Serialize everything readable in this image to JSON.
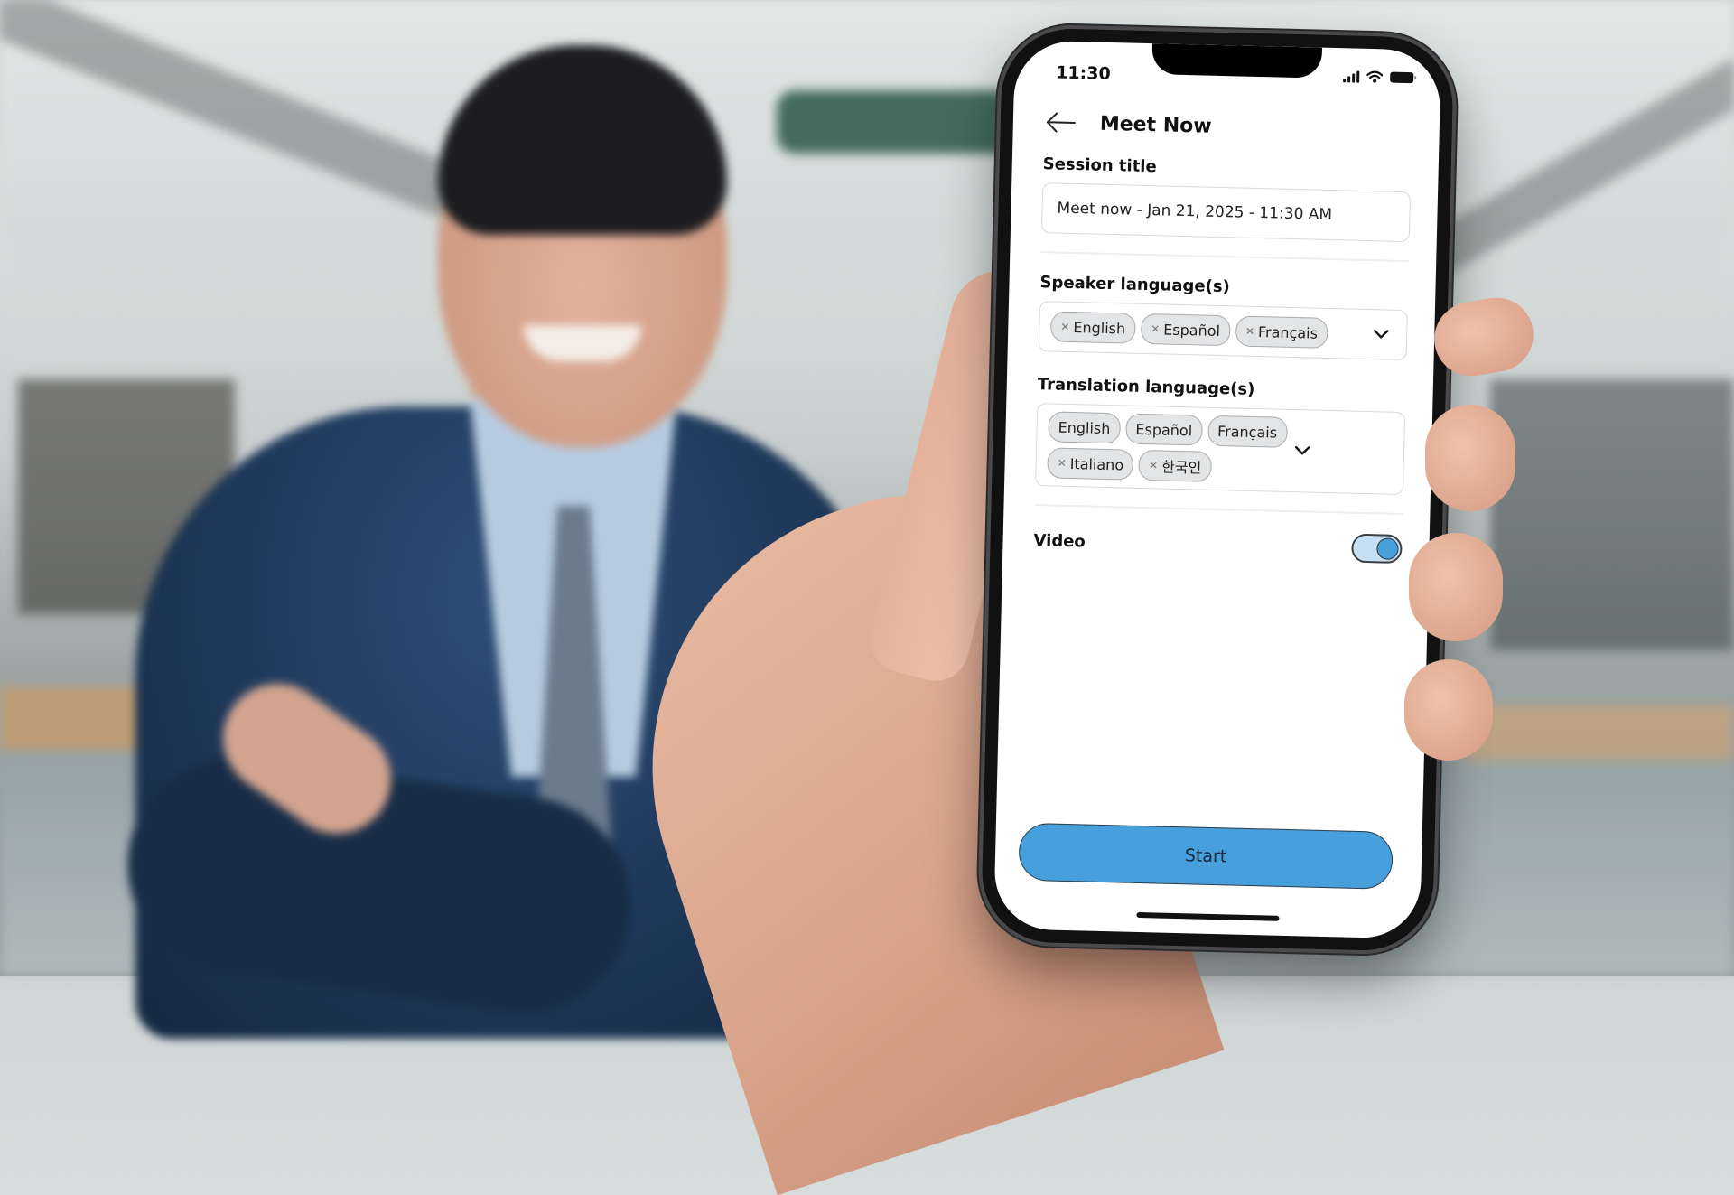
{
  "status_bar": {
    "time": "11:30",
    "icons": [
      "cellular-signal-icon",
      "wifi-icon",
      "battery-icon"
    ]
  },
  "app_bar": {
    "back_icon": "arrow-left-icon",
    "title": "Meet Now"
  },
  "session_title": {
    "label": "Session title",
    "value": "Meet now - Jan 21, 2025 - 11:30 AM"
  },
  "speaker_languages": {
    "label": "Speaker language(s)",
    "chips": [
      {
        "label": "English",
        "removable": true
      },
      {
        "label": "Español",
        "removable": true
      },
      {
        "label": "Français",
        "removable": true
      }
    ],
    "dropdown_icon": "chevron-down-icon"
  },
  "translation_languages": {
    "label": "Translation language(s)",
    "chips": [
      {
        "label": "English",
        "removable": false
      },
      {
        "label": "Español",
        "removable": false
      },
      {
        "label": "Français",
        "removable": false
      },
      {
        "label": "Italiano",
        "removable": true
      },
      {
        "label": "한국인",
        "removable": true
      }
    ],
    "dropdown_icon": "chevron-down-icon"
  },
  "video": {
    "label": "Video",
    "enabled": true
  },
  "actions": {
    "start_label": "Start"
  },
  "colors": {
    "primary": "#479fdb",
    "toggle_track_on": "#c7dff2",
    "chip_bg": "#e3e4e5"
  }
}
